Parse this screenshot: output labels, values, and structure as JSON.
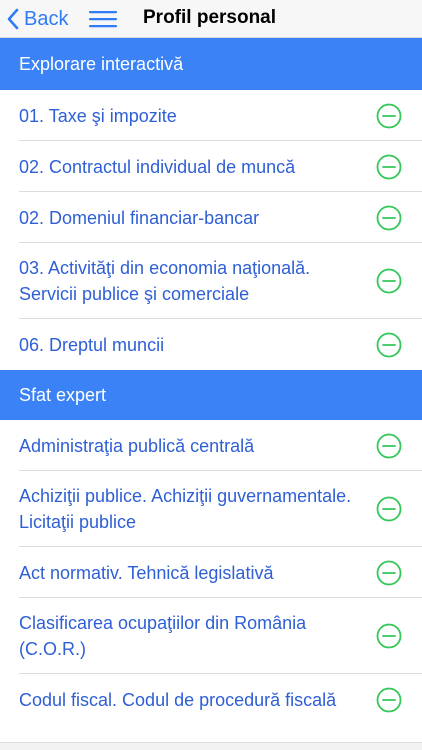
{
  "navbar": {
    "back_label": "Back",
    "title": "Profil personal"
  },
  "sections": [
    {
      "header": "Explorare interactivă",
      "items": [
        {
          "label": "01. Taxe şi impozite"
        },
        {
          "label": "02. Contractul individual de muncă"
        },
        {
          "label": "02. Domeniul financiar-bancar"
        },
        {
          "label": "03. Activităţi din economia naţională. Servicii publice şi comerciale"
        },
        {
          "label": "06. Dreptul muncii"
        }
      ]
    },
    {
      "header": "Sfat expert",
      "items": [
        {
          "label": "Administraţia publică centrală"
        },
        {
          "label": "Achiziţii publice. Achiziţii guvernamentale. Licitaţii publice"
        },
        {
          "label": "Act normativ. Tehnică legislativă"
        },
        {
          "label": "Clasificarea ocupaţiilor din România (C.O.R.)"
        },
        {
          "label": "Codul fiscal. Codul de procedură fiscală"
        }
      ]
    }
  ],
  "icons": {
    "back": "chevron-left-icon",
    "menu": "hamburger-menu-icon",
    "remove": "minus-circle-icon"
  },
  "colors": {
    "accent": "#2f7cf6",
    "section_header": "#3b82f6",
    "item_text": "#2e5fd6",
    "remove_icon": "#34c759"
  }
}
